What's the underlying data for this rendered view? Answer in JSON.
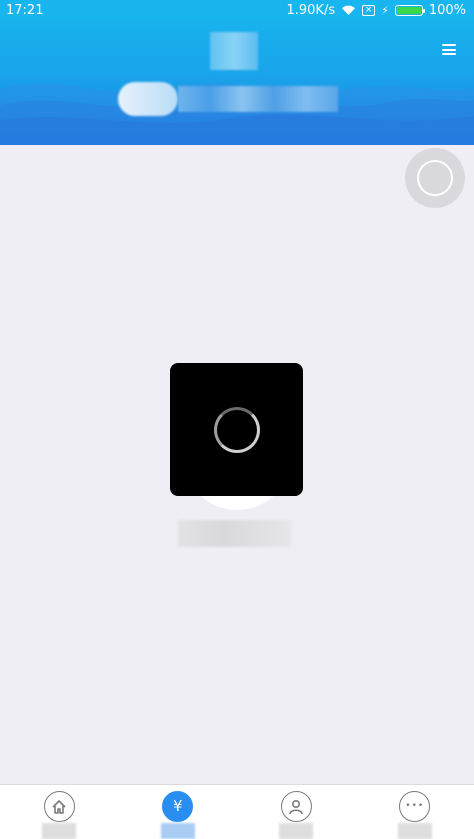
{
  "status_bar": {
    "time": "17:21",
    "network_speed": "1.90K/s",
    "battery_percent": "100%",
    "battery_level": 1.0,
    "icons": [
      "wifi-icon",
      "sim-icon",
      "charging-icon",
      "battery-icon"
    ]
  },
  "header": {
    "menu_icon": "hamburger-menu-icon"
  },
  "colors": {
    "header_top": "#18b2ee",
    "header_bottom": "#1a7fe0",
    "background": "#efeef4",
    "tab_active": "#2a8ef0"
  },
  "tab_bar": {
    "tabs": [
      {
        "icon": "home-icon",
        "glyph": "⌂",
        "active": false
      },
      {
        "icon": "yuan-icon",
        "glyph": "¥",
        "active": true
      },
      {
        "icon": "user-icon",
        "glyph": "",
        "active": false
      },
      {
        "icon": "more-icon",
        "glyph": "•••",
        "active": false
      }
    ]
  }
}
